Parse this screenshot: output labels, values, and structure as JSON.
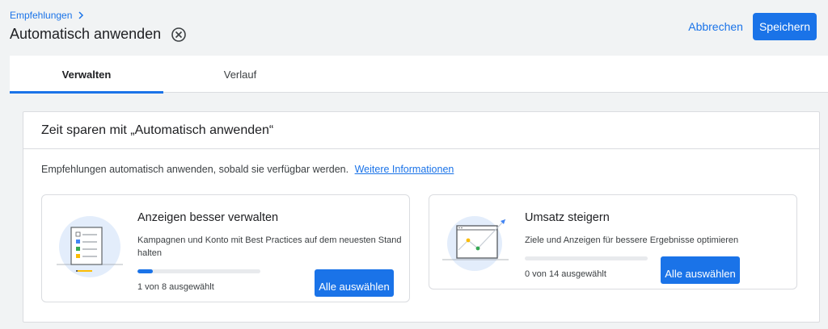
{
  "header": {
    "breadcrumb": "Empfehlungen",
    "title": "Automatisch anwenden",
    "cancel_label": "Abbrechen",
    "save_label": "Speichern"
  },
  "tabs": [
    {
      "label": "Verwalten",
      "active": true
    },
    {
      "label": "Verlauf",
      "active": false
    }
  ],
  "card": {
    "title": "Zeit sparen mit „Automatisch anwenden“",
    "description": "Empfehlungen automatisch anwenden, sobald sie verfügbar werden.",
    "link": "Weitere Informationen"
  },
  "subcards": [
    {
      "title": "Anzeigen besser verwalten",
      "description": "Kampagnen und Konto mit Best Practices auf dem neuesten Stand halten",
      "progress": 0.125,
      "count": "1 von 8 ausgewählt",
      "button": "Alle auswählen"
    },
    {
      "title": "Umsatz steigern",
      "description": "Ziele und Anzeigen für bessere Ergebnisse optimieren",
      "progress": 0,
      "count": "0 von 14 ausgewählt",
      "button": "Alle auswählen"
    }
  ],
  "colors": {
    "accent": "#1a73e8",
    "background": "#f1f3f4",
    "border": "#dadce0"
  },
  "icons": [
    "chevron-right-icon",
    "close-circle-icon",
    "checklist-illustration",
    "chart-growth-illustration"
  ]
}
